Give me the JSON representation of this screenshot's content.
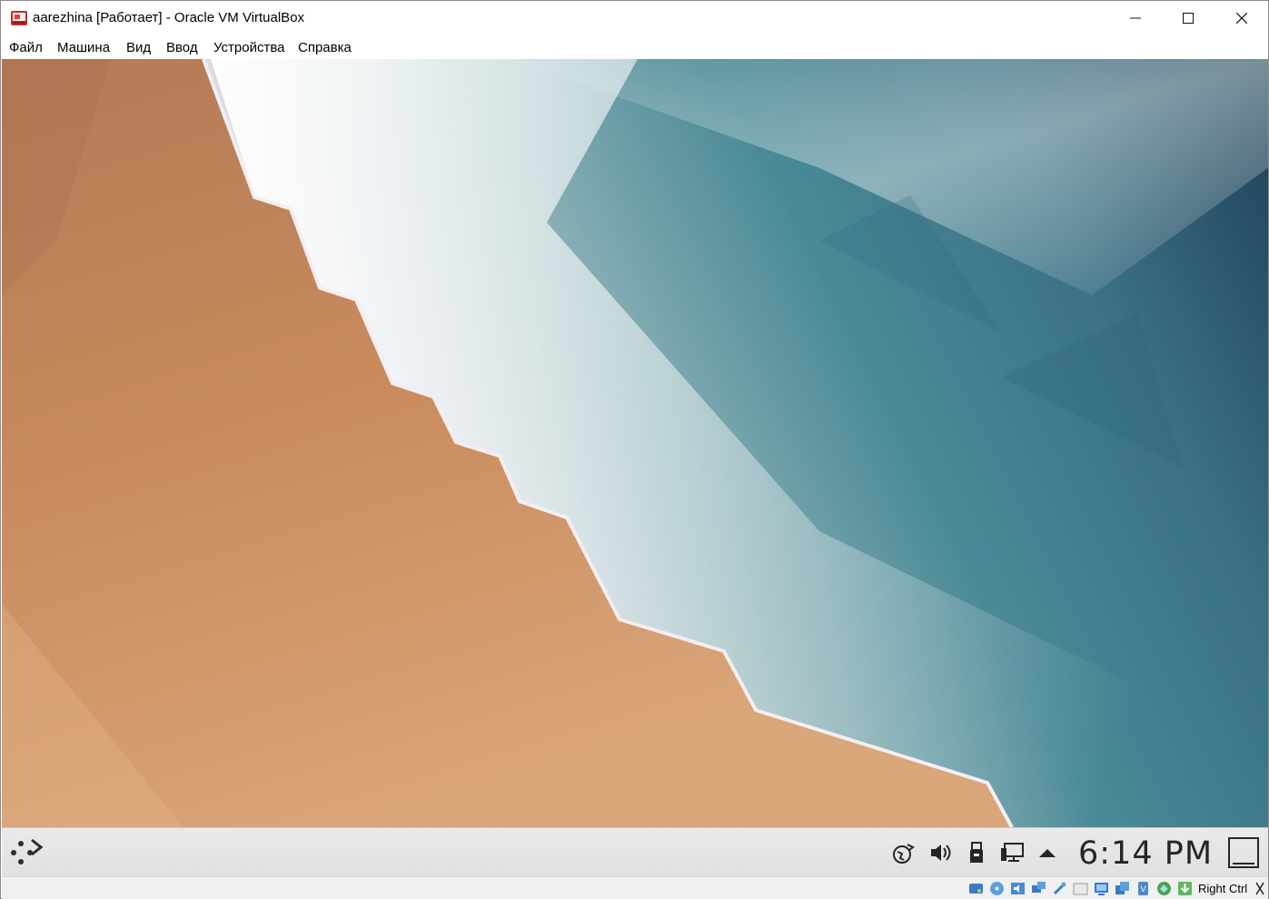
{
  "window": {
    "title": "aarezhina [Работает] - Oracle VM VirtualBox",
    "controls": [
      "minimize",
      "maximize",
      "close"
    ]
  },
  "menubar": {
    "items": [
      "Файл",
      "Машина",
      "Вид",
      "Ввод",
      "Устройства",
      "Справка"
    ]
  },
  "desktop": {
    "wallpaper": "sand-and-sea-lowpoly",
    "colors": {
      "sand": "#c88a5c",
      "foam": "#ece6ee",
      "sea": "#3f7d8e",
      "deep_sea": "#1f4559"
    }
  },
  "taskbar": {
    "launcher_icon": "application-launcher-icon",
    "tray_icons": [
      "network-icon",
      "volume-icon",
      "usb-device-icon",
      "display-icon",
      "expand-tray-icon"
    ],
    "clock": "6:14 PM",
    "show_desktop_icon": "show-desktop-icon"
  },
  "statusbar": {
    "icons": [
      "hard-disk-icon",
      "optical-disk-icon",
      "audio-icon",
      "network-icon",
      "usb-icon",
      "shared-folders-icon",
      "display-icon",
      "video-capture-icon",
      "mouse-integration-icon",
      "cpu-icon",
      "recording-icon",
      "download-icon"
    ],
    "host_key": "Right Ctrl",
    "keyboard_icon": "keyboard-capture-icon"
  }
}
